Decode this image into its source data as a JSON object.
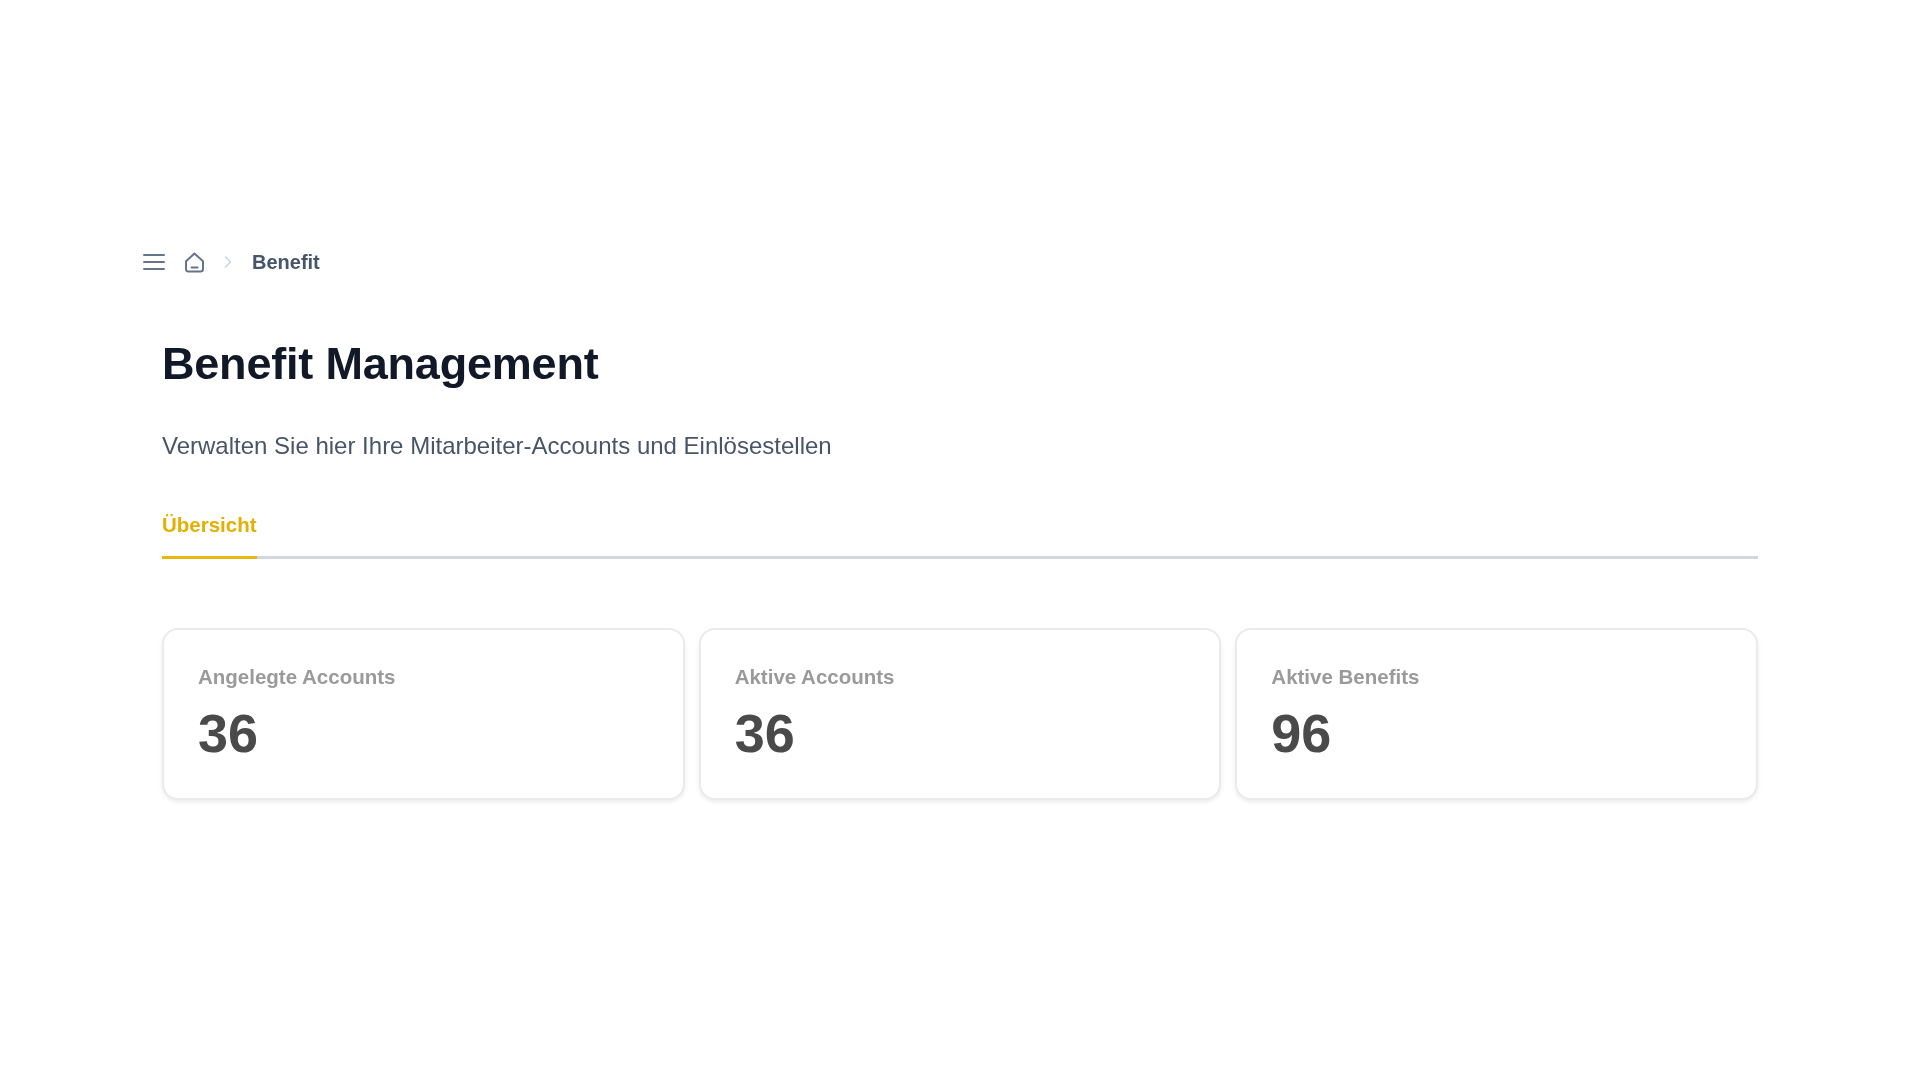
{
  "breadcrumb": {
    "items": [
      {
        "label": "Benefit"
      }
    ]
  },
  "header": {
    "title": "Benefit Management",
    "subtitle": "Verwalten Sie hier Ihre Mitarbeiter-Accounts und Einlösestellen"
  },
  "tabs": [
    {
      "label": "Übersicht",
      "selected": true
    }
  ],
  "stats": [
    {
      "label": "Angelegte Accounts",
      "value": "36"
    },
    {
      "label": "Aktive Accounts",
      "value": "36"
    },
    {
      "label": "Aktive Benefits",
      "value": "96"
    }
  ]
}
